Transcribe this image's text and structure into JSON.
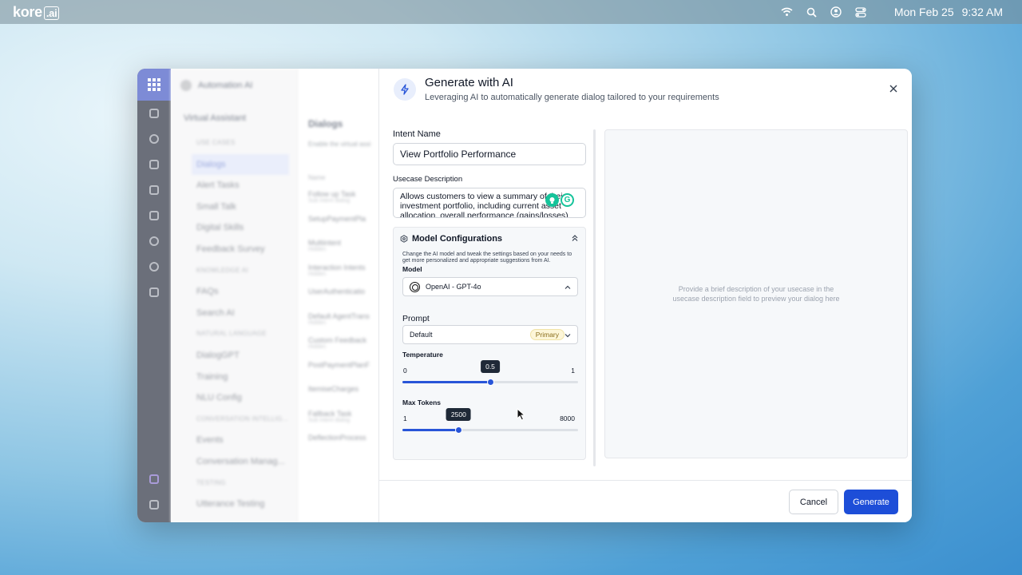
{
  "menubar": {
    "logo_text": "kore",
    "logo_suffix": ".ai",
    "icons": [
      "wifi-icon",
      "search-icon",
      "user-account-icon",
      "control-center-icon"
    ],
    "date": "Mon Feb 25",
    "time": "9:32 AM"
  },
  "background_app": {
    "app_title": "Automation AI",
    "section_title": "Virtual Assistant",
    "sidebar": [
      {
        "label": "USE CASES",
        "type": "section"
      },
      {
        "label": "Dialogs",
        "type": "item",
        "selected": true
      },
      {
        "label": "Alert Tasks",
        "type": "item"
      },
      {
        "label": "Small Talk",
        "type": "item"
      },
      {
        "label": "Digital Skills",
        "type": "item"
      },
      {
        "label": "Feedback Survey",
        "type": "item"
      },
      {
        "label": "KNOWLEDGE AI",
        "type": "section"
      },
      {
        "label": "FAQs",
        "type": "item"
      },
      {
        "label": "Search AI",
        "type": "item"
      },
      {
        "label": "NATURAL LANGUAGE",
        "type": "section"
      },
      {
        "label": "DialogGPT",
        "type": "item"
      },
      {
        "label": "Training",
        "type": "item"
      },
      {
        "label": "NLU Config",
        "type": "item"
      },
      {
        "label": "CONVERSATION INTELLIG...",
        "type": "section"
      },
      {
        "label": "Events",
        "type": "item"
      },
      {
        "label": "Conversation Manag...",
        "type": "item"
      },
      {
        "label": "TESTING",
        "type": "section"
      },
      {
        "label": "Utterance Testing",
        "type": "item"
      }
    ],
    "main_title": "Dialogs",
    "main_sub": "Enable the virtual assi",
    "column_header": "Name",
    "rows": [
      {
        "name": "Follow up Task",
        "sub": "Sub intent dialog"
      },
      {
        "name": "SetupPaymentPla",
        "sub": ""
      },
      {
        "name": "Multiintent",
        "sub": "Hidden"
      },
      {
        "name": "Interaction Intents",
        "sub": "Hidden"
      },
      {
        "name": "UserAuthenticatio",
        "sub": ""
      },
      {
        "name": "Default AgentTrans",
        "sub": "Hidden"
      },
      {
        "name": "Custom Feedback",
        "sub": "Hidden"
      },
      {
        "name": "PostPaymentPlanF",
        "sub": ""
      },
      {
        "name": "ItemiseCharges",
        "sub": ""
      },
      {
        "name": "Fallback Task",
        "sub": "Sub intent dialog"
      },
      {
        "name": "DeflectionProcess",
        "sub": ""
      }
    ]
  },
  "modal": {
    "title": "Generate with AI",
    "subtitle": "Leveraging AI to automatically generate dialog tailored to your requirements",
    "intent_label": "Intent Name",
    "intent_value": "View Portfolio Performance",
    "usecase_label": "Usecase Description",
    "usecase_value": "Allows customers to view a summary of their investment portfolio, including current asset allocation, overall performance (gains/losses)",
    "model_config": {
      "title": "Model Configurations",
      "description": "Change the AI model and tweak the settings based on your needs to get more personalized and appropriate suggestions from AI.",
      "model_label": "Model",
      "model_value": "OpenAI - GPT-4o",
      "prompt_label": "Prompt",
      "prompt_value": "Default",
      "prompt_badge": "Primary",
      "temperature": {
        "label": "Temperature",
        "min": "0",
        "max": "1",
        "value": 0.5,
        "display": "0.5",
        "fraction": 0.5
      },
      "max_tokens": {
        "label": "Max Tokens",
        "min": "1",
        "max": "8000",
        "value": 2500,
        "display": "2500",
        "fraction": 0.32
      }
    },
    "preview_text": "Provide a brief description of your usecase in the usecase description field to preview your dialog here",
    "cancel_label": "Cancel",
    "generate_label": "Generate"
  },
  "colors": {
    "accent": "#1d4ed8",
    "slider": "#2855d8",
    "badge_bg": "#fdf6d8",
    "grammarly": "#15c39a"
  }
}
